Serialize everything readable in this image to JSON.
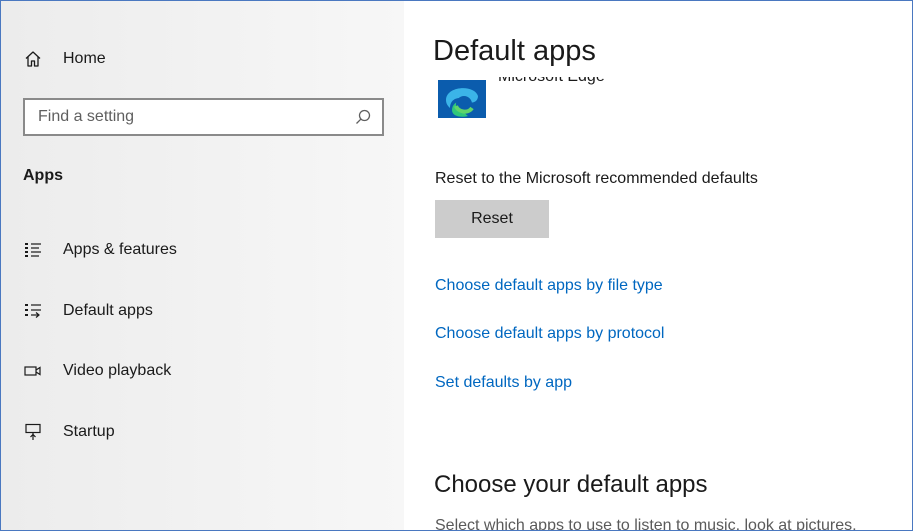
{
  "sidebar": {
    "home_label": "Home",
    "search": {
      "placeholder": "Find a setting",
      "value": ""
    },
    "section_title": "Apps",
    "items": [
      {
        "label": "Apps & features",
        "icon": "apps-features-list-icon"
      },
      {
        "label": "Default apps",
        "icon": "default-apps-list-icon"
      },
      {
        "label": "Video playback",
        "icon": "video-camera-icon"
      },
      {
        "label": "Startup",
        "icon": "startup-icon"
      }
    ]
  },
  "main": {
    "title": "Default apps",
    "current_browser": {
      "name": "Microsoft Edge",
      "icon": "microsoft-edge-icon"
    },
    "reset_caption": "Reset to the Microsoft recommended defaults",
    "reset_button": "Reset",
    "links": [
      "Choose default apps by file type",
      "Choose default apps by protocol",
      "Set defaults by app"
    ],
    "subheading": "Choose your default apps",
    "description": "Select which apps to use to listen to music, look at pictures,"
  },
  "colors": {
    "link": "#0067c0",
    "button_bg": "#cccccc",
    "sidebar_bg": "#f2f2f2",
    "window_border": "#4a78c0"
  }
}
